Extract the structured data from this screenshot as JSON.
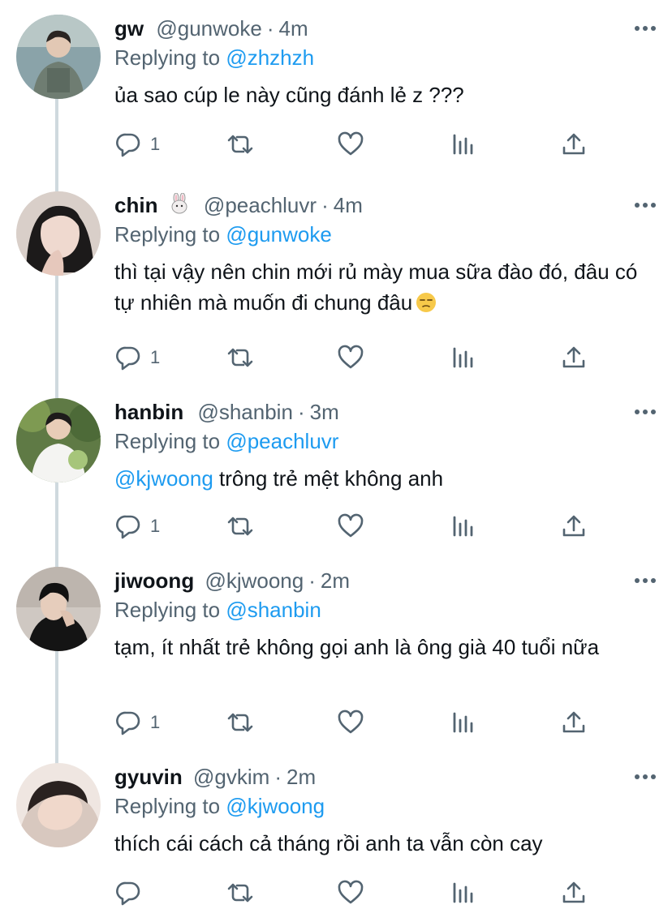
{
  "thread": [
    {
      "name": "gw",
      "emoji": "",
      "handle": "@gunwoke",
      "dot": "·",
      "time": "4m",
      "replying_prefix": "Replying to",
      "replying_to": "@zhzhzh",
      "mention": "",
      "text": "ủa sao cúp le này cũng đánh lẻ z ???",
      "text_emoji": "",
      "reply_count": "1"
    },
    {
      "name": "chin",
      "emoji": "bunny-emoji",
      "handle": "@peachluvr",
      "dot": "·",
      "time": "4m",
      "replying_prefix": "Replying to",
      "replying_to": "@gunwoke",
      "mention": "",
      "text": "thì tại vậy nên chin mới rủ mày mua sữa đào đó, đâu có tự nhiên mà muốn đi chung đâu",
      "text_emoji": "unamused-face-emoji",
      "reply_count": "1"
    },
    {
      "name": "hanbin",
      "emoji": "",
      "handle": "@shanbin",
      "dot": "·",
      "time": "3m",
      "replying_prefix": "Replying to",
      "replying_to": "@peachluvr",
      "mention": "@kjwoong",
      "text": " trông trẻ mệt không anh",
      "text_emoji": "",
      "reply_count": "1"
    },
    {
      "name": "jiwoong",
      "emoji": "",
      "handle": "@kjwoong",
      "dot": "·",
      "time": "2m",
      "replying_prefix": "Replying to",
      "replying_to": "@shanbin",
      "mention": "",
      "text": "tạm, ít nhất trẻ không gọi anh là ông già 40 tuổi nữa",
      "text_emoji": "",
      "reply_count": "1"
    },
    {
      "name": "gyuvin",
      "emoji": "",
      "handle": "@gvkim",
      "dot": "·",
      "time": "2m",
      "replying_prefix": "Replying to",
      "replying_to": "@kjwoong",
      "mention": "",
      "text": "thích cái cách cả tháng rồi anh ta vẫn còn cay",
      "text_emoji": "",
      "reply_count": ""
    }
  ],
  "colors": {
    "text": "#0f1419",
    "secondary": "#536471",
    "link": "#1d9bf0",
    "thread_line": "#cfd9de"
  },
  "icons": {
    "reply": "comment-icon",
    "retweet": "retweet-icon",
    "like": "heart-icon",
    "views": "bar-chart-icon",
    "share": "share-icon",
    "more": "more-dots-icon"
  }
}
